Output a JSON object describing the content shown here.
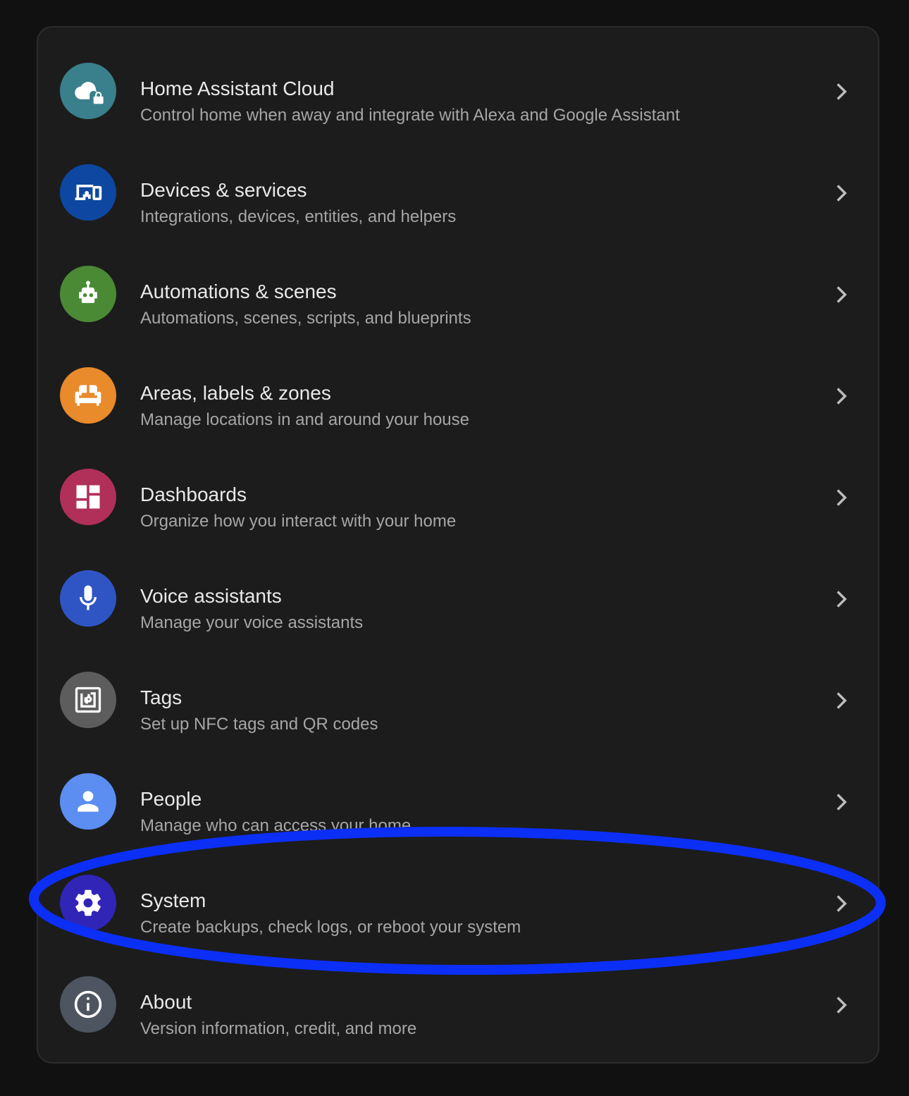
{
  "colors": {
    "page_background": "#111111",
    "card_background": "#1c1c1c",
    "title_text": "#e9e9e9",
    "subtitle_text": "#a6a6a6",
    "chevron": "#bdbdbd",
    "annotation_ellipse": "#0b2ff5"
  },
  "settings": {
    "items": [
      {
        "id": "cloud",
        "title": "Home Assistant Cloud",
        "subtitle": "Control home when away and integrate with Alexa and Google Assistant",
        "icon": "cloud-lock-icon",
        "icon_color": "#3a7f8c"
      },
      {
        "id": "devices",
        "title": "Devices & services",
        "subtitle": "Integrations, devices, entities, and helpers",
        "icon": "devices-icon",
        "icon_color": "#0d47a1"
      },
      {
        "id": "automations",
        "title": "Automations & scenes",
        "subtitle": "Automations, scenes, scripts, and blueprints",
        "icon": "robot-icon",
        "icon_color": "#4a8a35"
      },
      {
        "id": "areas",
        "title": "Areas, labels & zones",
        "subtitle": "Manage locations in and around your house",
        "icon": "sofa-icon",
        "icon_color": "#e98a2b"
      },
      {
        "id": "dashboards",
        "title": "Dashboards",
        "subtitle": "Organize how you interact with your home",
        "icon": "dashboard-icon",
        "icon_color": "#b0305a"
      },
      {
        "id": "voice",
        "title": "Voice assistants",
        "subtitle": "Manage your voice assistants",
        "icon": "microphone-icon",
        "icon_color": "#2f55c5"
      },
      {
        "id": "tags",
        "title": "Tags",
        "subtitle": "Set up NFC tags and QR codes",
        "icon": "nfc-tag-icon",
        "icon_color": "#5d5d5d"
      },
      {
        "id": "people",
        "title": "People",
        "subtitle": "Manage who can access your home",
        "icon": "person-icon",
        "icon_color": "#5c8ef1"
      },
      {
        "id": "system",
        "title": "System",
        "subtitle": "Create backups, check logs, or reboot your system",
        "icon": "gear-icon",
        "icon_color": "#3025b7"
      },
      {
        "id": "about",
        "title": "About",
        "subtitle": "Version information, credit, and more",
        "icon": "info-icon",
        "icon_color": "#4c5560"
      }
    ]
  }
}
